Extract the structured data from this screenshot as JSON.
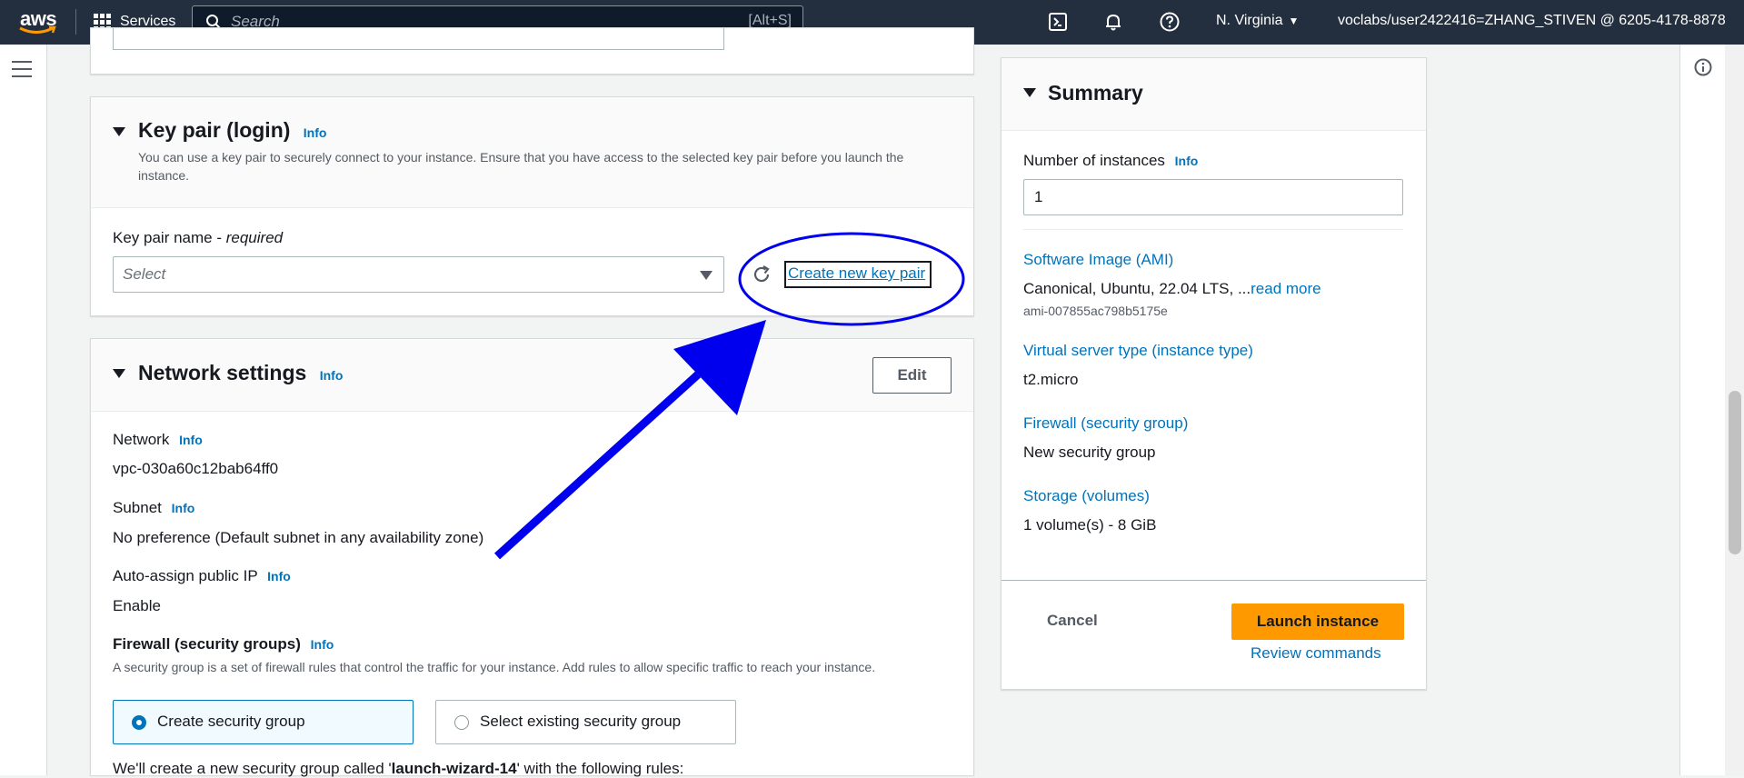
{
  "topnav": {
    "logo_text": "aws",
    "services_label": "Services",
    "search_placeholder": "Search",
    "search_shortcut": "[Alt+S]",
    "region": "N. Virginia",
    "account": "voclabs/user2422416=ZHANG_STIVEN @ 6205-4178-8878",
    "icons": [
      "cloudshell-icon",
      "bell-icon",
      "help-icon"
    ]
  },
  "key_pair": {
    "title": "Key pair (login)",
    "info": "Info",
    "description": "You can use a key pair to securely connect to your instance. Ensure that you have access to the selected key pair before you launch the instance.",
    "name_label": "Key pair name - ",
    "required": "required",
    "select_placeholder": "Select",
    "create_link": "Create new key pair"
  },
  "network": {
    "title": "Network settings",
    "info": "Info",
    "edit_label": "Edit",
    "network_label": "Network",
    "network_value": "vpc-030a60c12bab64ff0",
    "subnet_label": "Subnet",
    "subnet_value": "No preference (Default subnet in any availability zone)",
    "public_ip_label": "Auto-assign public IP",
    "public_ip_value": "Enable",
    "firewall_label": "Firewall (security groups)",
    "firewall_desc": "A security group is a set of firewall rules that control the traffic for your instance. Add rules to allow specific traffic to reach your instance.",
    "create_sg": "Create security group",
    "select_sg": "Select existing security group",
    "sg_note_prefix": "We'll create a new security group called '",
    "sg_name": "launch-wizard-14",
    "sg_note_suffix": "' with the following rules:"
  },
  "summary": {
    "title": "Summary",
    "num_label": "Number of instances",
    "info": "Info",
    "num_value": "1",
    "ami_label": "Software Image (AMI)",
    "ami_value": "Canonical, Ubuntu, 22.04 LTS, ...",
    "read_more": "read more",
    "ami_id": "ami-007855ac798b5175e",
    "type_label": "Virtual server type (instance type)",
    "type_value": "t2.micro",
    "firewall_label": "Firewall (security group)",
    "firewall_value": "New security group",
    "storage_label": "Storage (volumes)",
    "storage_value": "1 volume(s) - 8 GiB",
    "cancel_label": "Cancel",
    "launch_label": "Launch instance",
    "review_label": "Review commands"
  },
  "annotation": {
    "color": "#0000ee"
  }
}
